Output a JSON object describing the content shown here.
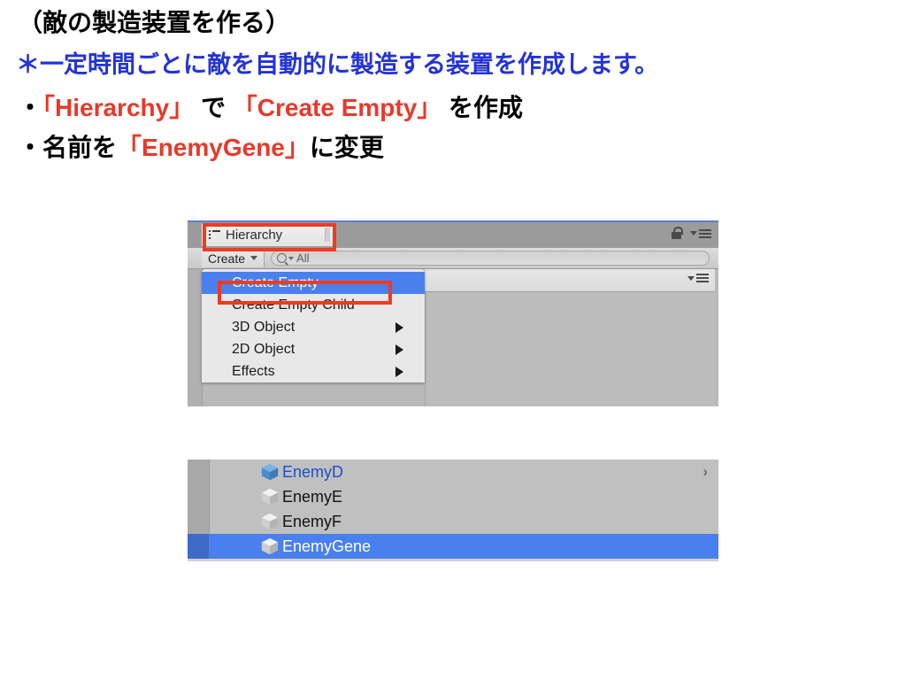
{
  "slide": {
    "title": "（敵の製造装置を作る）",
    "note": "＊一定時間ごとに敵を自動的に製造する装置を作成します。",
    "bullet1": {
      "bullet": "・",
      "part1": "「Hierarchy」",
      "part2": " で ",
      "part3": "「Create Empty」",
      "part4": " を作成"
    },
    "bullet2": {
      "bullet": "・",
      "part1": "名前を",
      "part2": "「EnemyGene」",
      "part3": "に変更"
    }
  },
  "unity_top": {
    "tab": {
      "label": "Hierarchy",
      "icon": "list-icon"
    },
    "lock_icon": "lock-icon",
    "panel_menu_icon": "dropdown-menu-icon",
    "toolbar": {
      "create_button": "Create",
      "search_value": "All",
      "search_icon": "search-icon"
    },
    "context_menu": {
      "items": [
        {
          "label": "Create Empty",
          "selected": true,
          "submenu": false
        },
        {
          "label": "Create Empty Child",
          "selected": false,
          "submenu": false
        },
        {
          "label": "3D Object",
          "selected": false,
          "submenu": true
        },
        {
          "label": "2D Object",
          "selected": false,
          "submenu": true
        },
        {
          "label": "Effects",
          "selected": false,
          "submenu": true
        }
      ]
    },
    "right_panel_menu_icon": "dropdown-menu-icon"
  },
  "unity_bottom": {
    "rows": [
      {
        "label": "EnemyD",
        "style": "prefab",
        "selected": false,
        "chevron": "›"
      },
      {
        "label": "EnemyE",
        "style": "normal",
        "selected": false,
        "chevron": ""
      },
      {
        "label": "EnemyF",
        "style": "normal",
        "selected": false,
        "chevron": ""
      },
      {
        "label": "EnemyGene",
        "style": "normal",
        "selected": true,
        "chevron": ""
      }
    ]
  },
  "colors": {
    "accent_red": "#e8392a",
    "accent_blue": "#2333d6",
    "selection_blue": "#4a80ee",
    "annotation_red": "#ef3b20",
    "prefab_blue": "#1a4fcc"
  }
}
